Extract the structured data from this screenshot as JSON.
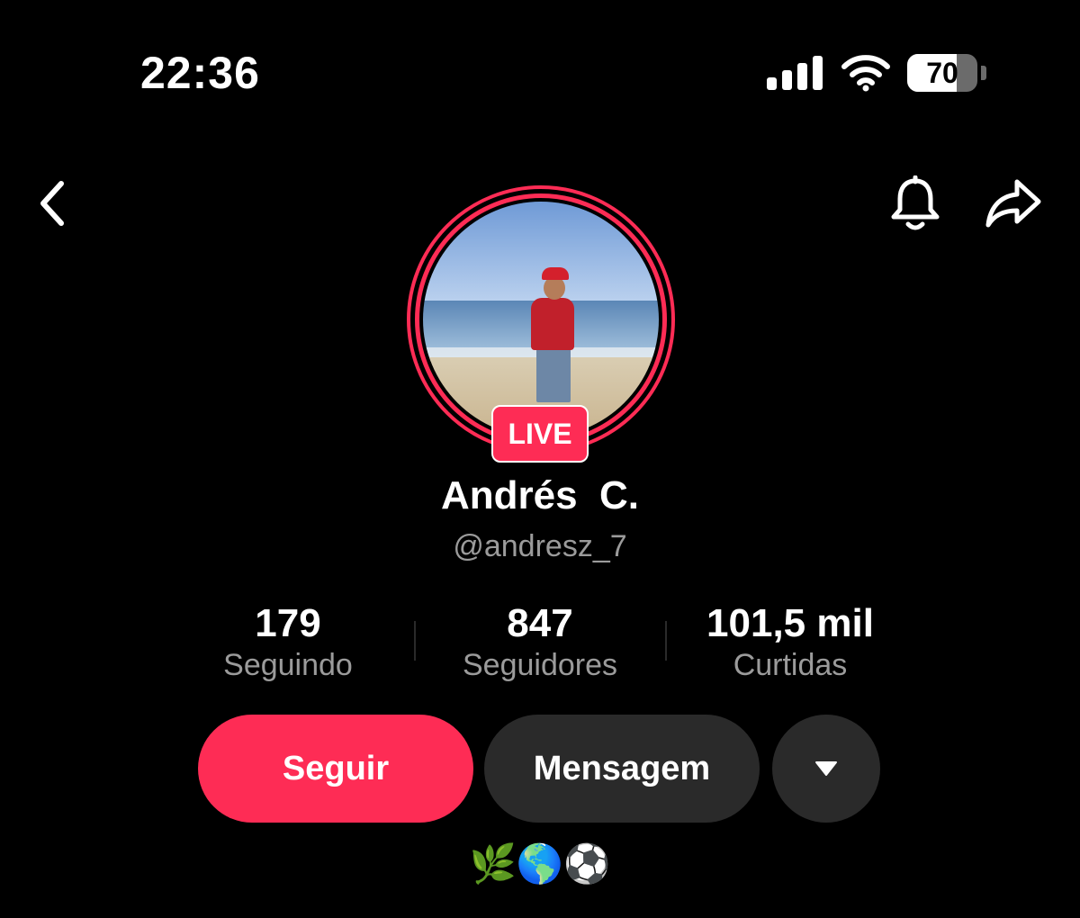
{
  "status_bar": {
    "time": "22:36",
    "battery_percent": "70",
    "battery_level": 0.7
  },
  "profile": {
    "display_name": "Andrés  C.",
    "username": "@andresz_7",
    "live_badge": "LIVE",
    "bio": "🌿🌎⚽️"
  },
  "stats": [
    {
      "value": "179",
      "label": "Seguindo"
    },
    {
      "value": "847",
      "label": "Seguidores"
    },
    {
      "value": "101,5 mil",
      "label": "Curtidas"
    }
  ],
  "actions": {
    "follow_label": "Seguir",
    "message_label": "Mensagem"
  },
  "icons": {
    "back": "chevron-left-icon",
    "notifications": "bell-icon",
    "share": "share-arrow-icon",
    "more": "caret-down-icon"
  },
  "colors": {
    "accent": "#fe2c55",
    "background": "#000000",
    "secondary_button": "#2a2a2a",
    "muted_text": "#9b9b9b"
  }
}
